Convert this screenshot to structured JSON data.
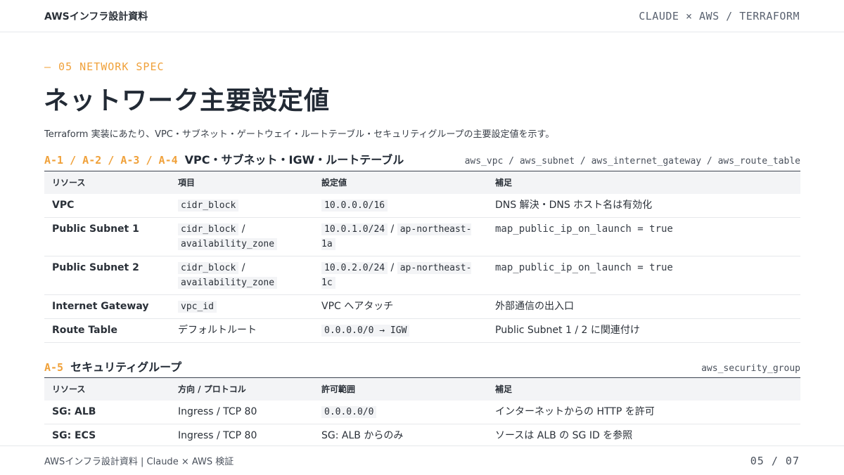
{
  "header": {
    "brand": "AWSインフラ設計資料",
    "tagline": "CLAUDE × AWS / TERRAFORM"
  },
  "section": {
    "label": "— 05  NETWORK SPEC",
    "title": "ネットワーク主要設定値",
    "lead": "Terraform 実装にあたり、VPC・サブネット・ゲートウェイ・ルートテーブル・セキュリティグループの主要設定値を示す。"
  },
  "network_table": {
    "ids": "A-1 / A-2 / A-3 / A-4",
    "title": "VPC・サブネット・IGW・ルートテーブル",
    "resources": "aws_vpc / aws_subnet / aws_internet_gateway / aws_route_table",
    "headers": [
      "リソース",
      "項目",
      "設定値",
      "補足"
    ],
    "rows": [
      {
        "resource": "VPC",
        "item": [
          {
            "code": "cidr_block"
          }
        ],
        "value": [
          {
            "code": "10.0.0.0/16"
          }
        ],
        "note": "DNS 解決・DNS ホスト名は有効化",
        "note_mono": false
      },
      {
        "resource": "Public Subnet 1",
        "item": [
          {
            "code": "cidr_block"
          },
          {
            "text": " / "
          },
          {
            "code": "availability_zone"
          }
        ],
        "value": [
          {
            "code": "10.0.1.0/24"
          },
          {
            "text": " / "
          },
          {
            "code": "ap-northeast-1a"
          }
        ],
        "note": "map_public_ip_on_launch = true",
        "note_mono": true
      },
      {
        "resource": "Public Subnet 2",
        "item": [
          {
            "code": "cidr_block"
          },
          {
            "text": " / "
          },
          {
            "code": "availability_zone"
          }
        ],
        "value": [
          {
            "code": "10.0.2.0/24"
          },
          {
            "text": " / "
          },
          {
            "code": "ap-northeast-1c"
          }
        ],
        "note": "map_public_ip_on_launch = true",
        "note_mono": true
      },
      {
        "resource": "Internet Gateway",
        "item": [
          {
            "code": "vpc_id"
          }
        ],
        "value": [
          {
            "text": "VPC へアタッチ"
          }
        ],
        "note": "外部通信の出入口",
        "note_mono": false
      },
      {
        "resource": "Route Table",
        "item": [
          {
            "text": "デフォルトルート"
          }
        ],
        "value": [
          {
            "code": "0.0.0.0/0 → IGW"
          }
        ],
        "note": "Public Subnet 1 / 2 に関連付け",
        "note_mono": false
      }
    ]
  },
  "sg_table": {
    "ids": "A-5",
    "title": "セキュリティグループ",
    "resources": "aws_security_group",
    "headers": [
      "リソース",
      "方向 / プロトコル",
      "許可範囲",
      "補足"
    ],
    "rows": [
      {
        "resource": "SG: ALB",
        "item": [
          {
            "text": "Ingress / TCP 80"
          }
        ],
        "value": [
          {
            "code": "0.0.0.0/0"
          }
        ],
        "note": "インターネットからの HTTP を許可",
        "note_mono": false
      },
      {
        "resource": "SG: ECS",
        "item": [
          {
            "text": "Ingress / TCP 80"
          }
        ],
        "value": [
          {
            "text": "SG: ALB からのみ"
          }
        ],
        "note": "ソースは ALB の SG ID を参照",
        "note_mono": false
      }
    ]
  },
  "footer": {
    "text": "AWSインフラ設計資料 | Claude × AWS 検証",
    "pager": "05 / 07"
  }
}
